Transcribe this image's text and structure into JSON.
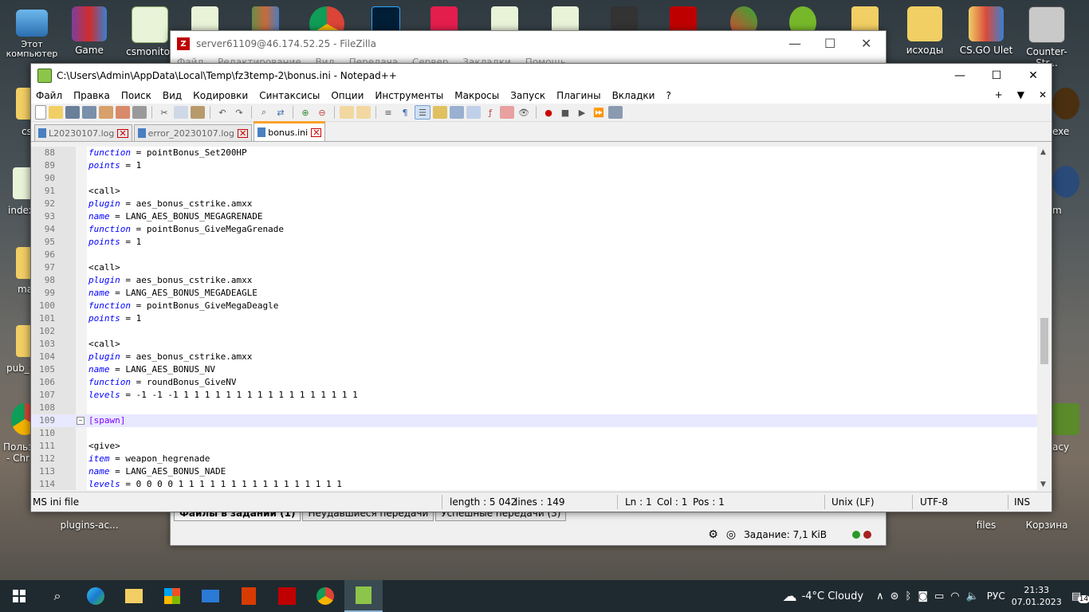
{
  "desktop": {
    "icons": [
      {
        "label": "Этот компьютер",
        "name": "this-pc"
      },
      {
        "label": "Game",
        "name": "game"
      },
      {
        "label": "csmonitor",
        "name": "csmonitor"
      },
      {
        "label": "исходы",
        "name": "ishody"
      },
      {
        "label": "CS.GO Ulet",
        "name": "csgo-ulet"
      },
      {
        "label": "Counter-Str...",
        "name": "counter-strike"
      },
      {
        "label": "plugins-ac...",
        "name": "plugins-ac"
      },
      {
        "label": "files",
        "name": "files"
      },
      {
        "label": "Корзина",
        "name": "recycle-bin"
      }
    ],
    "partial_labels": [
      "cs",
      "index",
      "ma",
      "pub_S",
      "Польз",
      "- Chr",
      "exe",
      "m",
      "acy"
    ]
  },
  "filezilla": {
    "title": "server61109@46.174.52.25 - FileZilla",
    "menu": [
      "Файл",
      "Редактирование",
      "Вид",
      "Передача",
      "Сервер",
      "Закладки",
      "Помощь"
    ],
    "tabs": [
      "Файлы в задании (1)",
      "Неудавшиеся передачи",
      "Успешные передачи (3)"
    ],
    "queue_status": "Задание: 7,1 KiB"
  },
  "notepad": {
    "title": "C:\\Users\\Admin\\AppData\\Local\\Temp\\fz3temp-2\\bonus.ini - Notepad++",
    "menu": [
      "Файл",
      "Правка",
      "Поиск",
      "Вид",
      "Кодировки",
      "Синтаксисы",
      "Опции",
      "Инструменты",
      "Макросы",
      "Запуск",
      "Плагины",
      "Вкладки",
      "?"
    ],
    "menu_right": [
      "+",
      "▼",
      "✕"
    ],
    "tabs": [
      {
        "label": "L20230107.log",
        "active": false
      },
      {
        "label": "error_20230107.log",
        "active": false
      },
      {
        "label": "bonus.ini",
        "active": true
      }
    ],
    "lines": [
      {
        "n": "88",
        "key": "function",
        "rest": " = pointBonus_Set200HP"
      },
      {
        "n": "89",
        "key": "points",
        "rest": " = 1"
      },
      {
        "n": "90",
        "text": ""
      },
      {
        "n": "91",
        "text": "<call>"
      },
      {
        "n": "92",
        "key": "plugin",
        "rest": " = aes_bonus_cstrike.amxx"
      },
      {
        "n": "93",
        "key": "name",
        "rest": " = LANG_AES_BONUS_MEGAGRENADE"
      },
      {
        "n": "94",
        "key": "function",
        "rest": " = pointBonus_GiveMegaGrenade"
      },
      {
        "n": "95",
        "key": "points",
        "rest": " = 1"
      },
      {
        "n": "96",
        "text": ""
      },
      {
        "n": "97",
        "text": "<call>"
      },
      {
        "n": "98",
        "key": "plugin",
        "rest": " = aes_bonus_cstrike.amxx"
      },
      {
        "n": "99",
        "key": "name",
        "rest": " = LANG_AES_BONUS_MEGADEAGLE"
      },
      {
        "n": "100",
        "key": "function",
        "rest": " = pointBonus_GiveMegaDeagle"
      },
      {
        "n": "101",
        "key": "points",
        "rest": " = 1"
      },
      {
        "n": "102",
        "text": ""
      },
      {
        "n": "103",
        "text": "<call>"
      },
      {
        "n": "104",
        "key": "plugin",
        "rest": " = aes_bonus_cstrike.amxx"
      },
      {
        "n": "105",
        "key": "name",
        "rest": " = LANG_AES_BONUS_NV"
      },
      {
        "n": "106",
        "key": "function",
        "rest": " = roundBonus_GiveNV"
      },
      {
        "n": "107",
        "key": "levels",
        "rest": " = -1 -1 -1 1 1 1 1 1 1 1 1 1 1 1 1 1 1 1 1 1"
      },
      {
        "n": "108",
        "text": ""
      },
      {
        "n": "109",
        "section": "[spawn]",
        "current": true
      },
      {
        "n": "110",
        "text": ""
      },
      {
        "n": "111",
        "text": "<give>"
      },
      {
        "n": "112",
        "key": "item",
        "rest": " = weapon_hegrenade"
      },
      {
        "n": "113",
        "key": "name",
        "rest": " = LANG_AES_BONUS_NADE"
      },
      {
        "n": "114",
        "key": "levels",
        "rest": " = 0 0 0 0 1 1 1 1 1 1 1 1 1 1 1 1 1 1 1 1"
      }
    ],
    "status": {
      "type": "MS ini file",
      "length": "length : 5 042",
      "lines": "lines : 149",
      "ln": "Ln : 1",
      "col": "Col : 1",
      "pos": "Pos : 1",
      "eol": "Unix (LF)",
      "encoding": "UTF-8",
      "mode": "INS"
    }
  },
  "taskbar": {
    "weather": "-4°C  Cloudy",
    "lang": "РУС",
    "time": "21:33",
    "date": "07.01.2023",
    "notifications": "14"
  }
}
